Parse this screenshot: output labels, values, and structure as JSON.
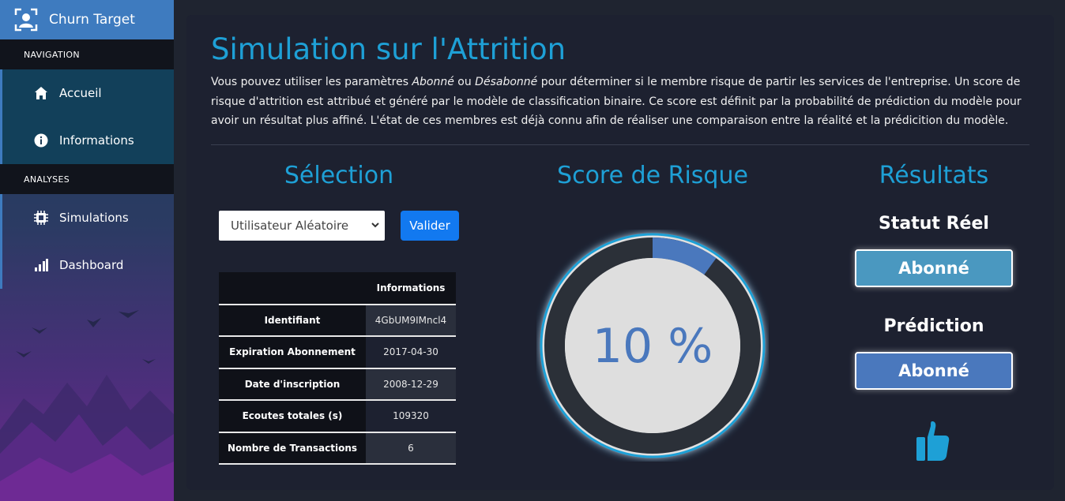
{
  "app": {
    "name": "Churn Target"
  },
  "nav": {
    "heading_navigation": "NAVIGATION",
    "heading_analyses": "ANALYSES",
    "items": [
      {
        "label": "Accueil",
        "icon": "home-icon"
      },
      {
        "label": "Informations",
        "icon": "info-icon"
      },
      {
        "label": "Simulations",
        "icon": "chip-icon"
      },
      {
        "label": "Dashboard",
        "icon": "bar-chart-icon"
      }
    ]
  },
  "page": {
    "title": "Simulation sur l'Attrition",
    "intro_1": "Vous pouvez utiliser les paramètres ",
    "intro_em1": "Abonné",
    "intro_2": " ou ",
    "intro_em2": "Désabonné",
    "intro_3": " pour déterminer si le membre risque de partir les services de l'entreprise. Un score de risque d'attrition est attribué et généré par le modèle de classification binaire. Ce score est définit par la probabilité de prédiction du modèle pour avoir un résultat plus affiné. L'état de ces membres est déjà connu afin de réaliser une comparaison entre la réalité et la prédicition du modèle."
  },
  "selection": {
    "title": "Sélection",
    "dropdown_value": "Utilisateur Aléatoire",
    "button_label": "Valider",
    "table_header": "Informations",
    "rows": [
      {
        "key": "Identifiant",
        "value": "4GbUM9IMncl4"
      },
      {
        "key": "Expiration Abonnement",
        "value": "2017-04-30"
      },
      {
        "key": "Date d'inscription",
        "value": "2008-12-29"
      },
      {
        "key": "Ecoutes totales (s)",
        "value": "109320"
      },
      {
        "key": "Nombre de Transactions",
        "value": "6"
      }
    ]
  },
  "score": {
    "title": "Score de Risque",
    "value_text": "10 %",
    "fraction": 0.1
  },
  "results": {
    "title": "Résultats",
    "real_label": "Statut Réel",
    "real_value": "Abonné",
    "pred_label": "Prédiction",
    "pred_value": "Abonné",
    "icon": "thumbs-up-icon"
  },
  "colors": {
    "accent": "#1ea0d6",
    "brand": "#3e7bbf",
    "real_box": "#4a98c0",
    "pred_box": "#4a78bd",
    "gauge_arc": "#4a78bd"
  }
}
